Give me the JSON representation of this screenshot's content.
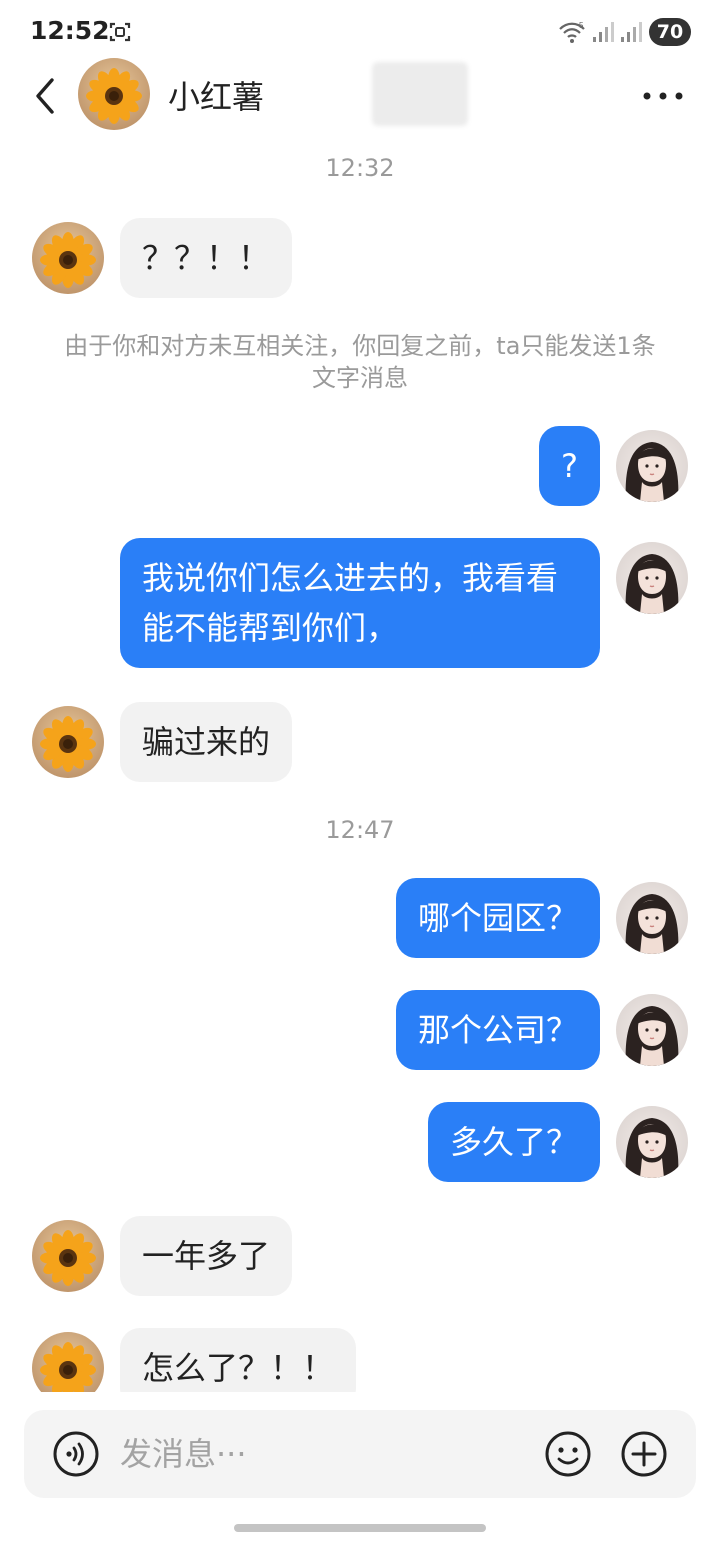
{
  "status_bar": {
    "time": "12:52",
    "battery": "70",
    "wifi_badge": "5"
  },
  "header": {
    "contact_name": "小红薯"
  },
  "avatars": {
    "contact": "sunflower-avatar",
    "self": "girl-portrait-avatar"
  },
  "messages": [
    {
      "kind": "time",
      "text": "12:32"
    },
    {
      "kind": "in",
      "text": "？？！！"
    },
    {
      "kind": "notice",
      "text": "由于你和对方未互相关注，你回复之前，ta只能发送1条文字消息"
    },
    {
      "kind": "out",
      "text": "?"
    },
    {
      "kind": "out",
      "text": "我说你们怎么进去的，我看看能不能帮到你们，"
    },
    {
      "kind": "in",
      "text": "骗过来的"
    },
    {
      "kind": "time",
      "text": "12:47"
    },
    {
      "kind": "out",
      "text": "哪个园区？"
    },
    {
      "kind": "out",
      "text": "那个公司？"
    },
    {
      "kind": "out",
      "text": "多久了？"
    },
    {
      "kind": "in",
      "text": "一年多了"
    },
    {
      "kind": "in",
      "text": "怎么了？！！"
    }
  ],
  "input": {
    "placeholder": "发消息···"
  },
  "colors": {
    "outgoing_bubble": "#2a7ff7",
    "incoming_bubble": "#f2f2f2"
  }
}
